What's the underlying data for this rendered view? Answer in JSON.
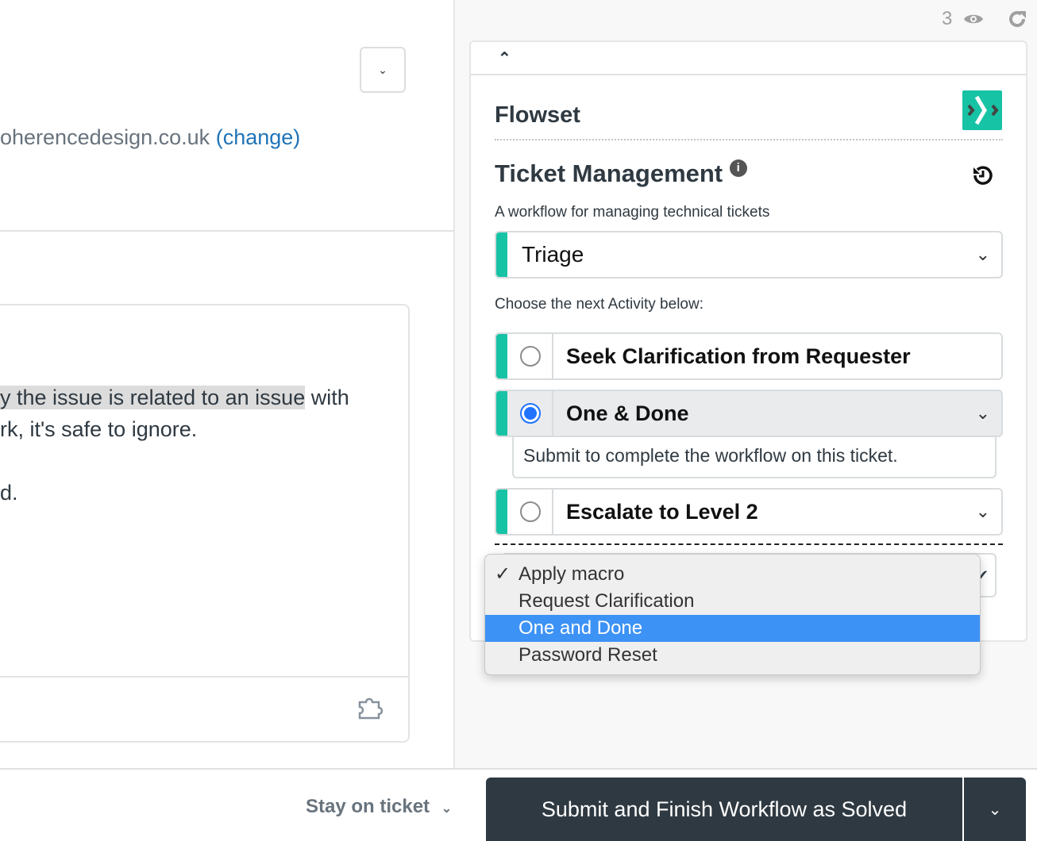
{
  "left": {
    "email_text": "oherencedesign.co.uk",
    "change_link": "(change)",
    "comment_lines": [
      {
        "highlighted": "y the issue is related to an issue",
        "rest": " with"
      },
      {
        "highlighted": "",
        "rest": "rk, it's safe to ignore."
      },
      {
        "highlighted": "",
        "rest": "d."
      }
    ]
  },
  "top": {
    "viewer_count": "3"
  },
  "panel": {
    "brand": "Flowset",
    "workflow_title": "Ticket Management",
    "workflow_description": "A workflow for managing technical tickets",
    "stage": "Triage",
    "choose_label": "Choose the next Activity below:",
    "activities": [
      {
        "label": "Seek Clarification from Requester",
        "selected": false
      },
      {
        "label": "One & Done",
        "selected": true,
        "description": "Submit to complete the workflow on this ticket."
      },
      {
        "label": "Escalate to Level 2",
        "selected": false
      }
    ],
    "accent": "#17c3a5"
  },
  "macro_menu": {
    "items": [
      "Apply macro",
      "Request Clarification",
      "One and Done",
      "Password Reset"
    ],
    "checked": "Apply macro",
    "highlighted": "One and Done"
  },
  "footer": {
    "stay_label": "Stay on ticket",
    "submit_label": "Submit and Finish Workflow as Solved"
  }
}
